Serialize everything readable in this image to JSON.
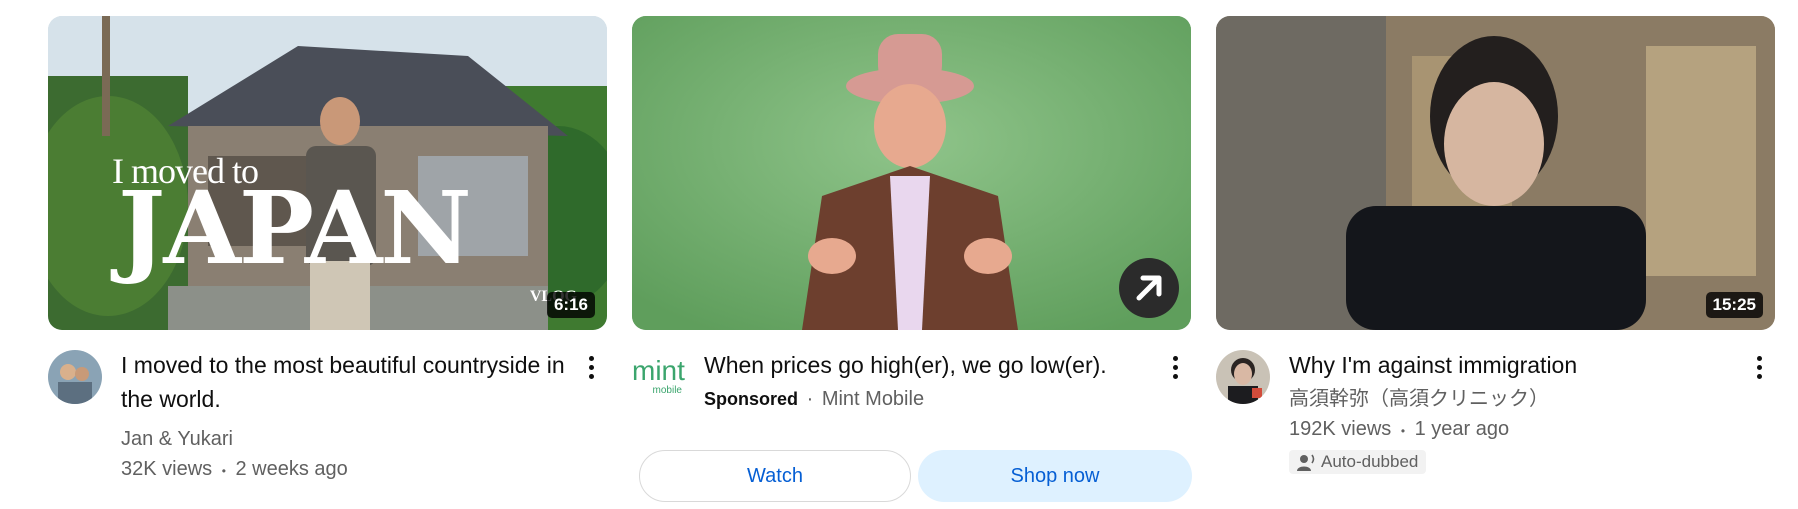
{
  "videos": [
    {
      "title": "I moved to the most beautiful countryside in the world.",
      "channel": "Jan & Yukari",
      "views": "32K views",
      "age": "2 weeks ago",
      "duration": "6:16",
      "thumb_text_small": "I moved to",
      "thumb_text_big": "JAPAN",
      "thumb_text_corner": "VLOG",
      "icon": "more-vert-icon"
    },
    {
      "title": "When prices go high(er), we go low(er).",
      "sponsored_label": "Sponsored",
      "advertiser": "Mint Mobile",
      "logo_text": "mint",
      "logo_subtext": "mobile",
      "watch_label": "Watch",
      "shop_label": "Shop now",
      "icon": "external-link-arrow-icon",
      "accent": "#065fd4",
      "shop_bg": "#def1ff"
    },
    {
      "title": "Why I'm against immigration",
      "channel": "高須幹弥（高須クリニック）",
      "views": "192K views",
      "age": "1 year ago",
      "duration": "15:25",
      "badge": "Auto-dubbed",
      "badge_icon": "person-voice-icon"
    }
  ],
  "separator": "•"
}
